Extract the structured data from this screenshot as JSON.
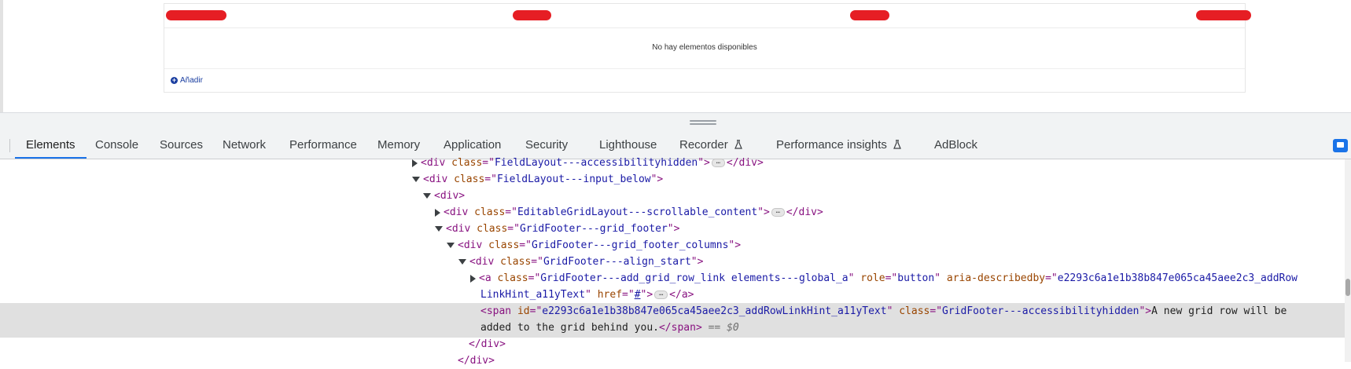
{
  "grid": {
    "empty_message": "No hay elementos disponibles",
    "add_label": "Añadir"
  },
  "devtools": {
    "tabs": [
      {
        "label": "Elements",
        "active": true
      },
      {
        "label": "Console"
      },
      {
        "label": "Sources"
      },
      {
        "label": "Network"
      },
      {
        "label": "Performance"
      },
      {
        "label": "Memory"
      },
      {
        "label": "Application"
      },
      {
        "label": "Security"
      },
      {
        "label": "Lighthouse"
      },
      {
        "label": "Recorder",
        "icon": "flask-icon"
      },
      {
        "label": "Performance insights",
        "icon": "flask-icon"
      },
      {
        "label": "AdBlock"
      }
    ]
  },
  "dom": {
    "l0": {
      "cls": "FieldLayout---accessibilityhidden"
    },
    "l1": {
      "cls": "FieldLayout---input_below"
    },
    "l3": {
      "cls": "EditableGridLayout---scrollable_content"
    },
    "l4": {
      "cls": "GridFooter---grid_footer"
    },
    "l5": {
      "cls": "GridFooter---grid_footer_columns"
    },
    "l6": {
      "cls": "GridFooter---align_start"
    },
    "l7": {
      "cls": "GridFooter---add_grid_row_link elements---global_a",
      "role": "button",
      "describedby_a": "e2293c6a1e1b38b847e065ca45aee2c3_addRow",
      "describedby_b": "LinkHint_a11yText",
      "href": "#"
    },
    "l8": {
      "id": "e2293c6a1e1b38b847e065ca45aee2c3_addRowLinkHint_a11yText",
      "cls": "GridFooter---accessibilityhidden",
      "text_a": "A new grid row will be",
      "text_b": "added to the grid behind you.",
      "marker": "== $0"
    }
  }
}
